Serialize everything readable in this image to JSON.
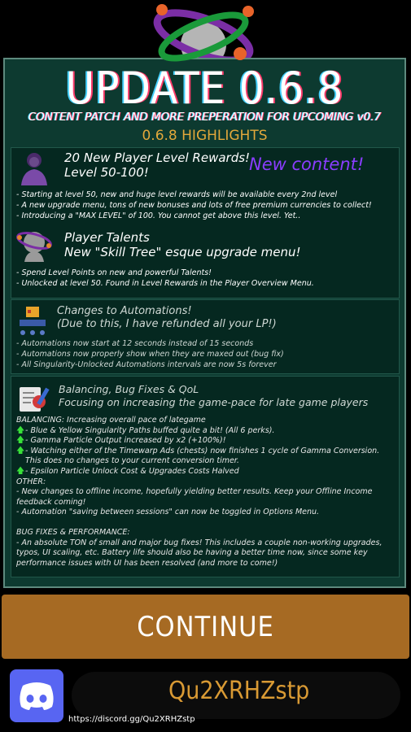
{
  "title": "UPDATE 0.6.8",
  "subtitle": "CONTENT PATCH AND MORE PREPERATION FOR UPCOMING v0.7",
  "highlights_label": "0.6.8 HIGHLIGHTS",
  "new_content_label": "New content!",
  "section1": {
    "heading1": "20 New Player Level Rewards!",
    "heading2": "Level 50-100!",
    "bullets": [
      "- Starting at level 50, new and huge level rewards will be available every 2nd level",
      "- A new upgrade menu, tons of new bonuses and lots of free premium currencies to collect!",
      "- Introducing a \"MAX LEVEL\" of 100. You cannot get above this level. Yet.."
    ]
  },
  "section2": {
    "heading1": "Player Talents",
    "heading2": "New \"Skill Tree\" esque upgrade menu!",
    "bullets": [
      "- Spend Level Points on new and powerful Talents!",
      "- Unlocked at level 50. Found in Level Rewards in the Player Overview Menu."
    ]
  },
  "section3": {
    "heading1": "Changes to Automations!",
    "heading2": "(Due to this, I have refunded all your LP!)",
    "bullets": [
      "- Automations now start at 12 seconds instead of 15 seconds",
      "- Automations now properly show when they are maxed out (bug fix)",
      "- All Singularity-Unlocked Automations intervals are now 5s forever"
    ]
  },
  "section4": {
    "heading1": "Balancing, Bug Fixes & QoL",
    "heading2": "Focusing on increasing the game-pace for late game players",
    "balancing_header": "BALANCING: Increasing overall pace of lategame",
    "balancing": [
      "- Blue & Yellow Singularity Paths buffed quite a bit! (All 6 perks).",
      "- Gamma Particle Output increased by x2 (+100%)!",
      "- Watching either of the Timewarp Ads (chests) now finishes 1 cycle of Gamma Conversion. This does no changes to your current conversion timer.",
      "- Epsilon Particle Unlock Cost & Upgrades Costs Halved"
    ],
    "other_header": "OTHER:",
    "other": [
      "- New changes to offline income, hopefully yielding better results. Keep your Offline Income feedback coming!",
      "- Automation \"saving between sessions\" can now be toggled in Options Menu."
    ],
    "bug_header": "BUG FIXES & PERFORMANCE:",
    "bug": [
      "- An absolute TON of small and major bug fixes! This includes a couple non-working upgrades, typos, UI scaling, etc. Battery life should also be having a better time now, since some key performance issues with UI has been resolved (and more to come!)"
    ]
  },
  "continue_label": "CONTINUE",
  "discord_code": "Qu2XRHZstp",
  "discord_url": "https://discord.gg/Qu2XRHZstp",
  "colors": {
    "panel": "#0d3a30",
    "box": "#052820",
    "accent_orange": "#e2a83b",
    "button": "#a66a23",
    "new_content": "#8a3dff",
    "discord": "#5865f2",
    "up_arrow": "#38e038"
  },
  "icons": [
    "atom-logo-icon",
    "player-avatar-icon",
    "talent-head-icon",
    "automation-robot-icon",
    "bug-fix-icon",
    "up-arrow-icon",
    "discord-icon"
  ]
}
